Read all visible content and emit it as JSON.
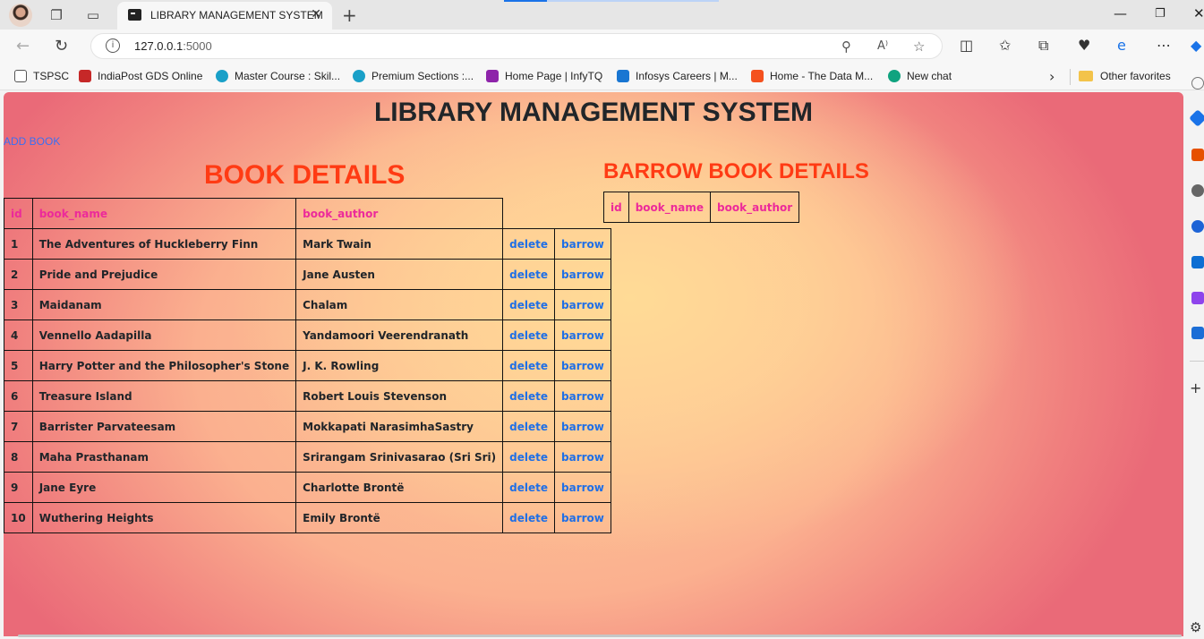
{
  "browser": {
    "tab_title": "LIBRARY MANAGEMENT SYSTEM",
    "url_host": "127.0.0.1",
    "url_port": ":5000",
    "bookmarks": [
      {
        "label": "TSPSC",
        "icon": "page-icon",
        "color": "#555555"
      },
      {
        "label": "IndiaPost GDS Online",
        "icon": "indiapost-icon",
        "color": "#c62828"
      },
      {
        "label": "Master Course : Skil...",
        "icon": "skill-icon",
        "color": "#1aa0c8"
      },
      {
        "label": "Premium Sections :...",
        "icon": "skill-icon",
        "color": "#1aa0c8"
      },
      {
        "label": "Home Page | InfyTQ",
        "icon": "infytq-icon",
        "color": "#8e24aa"
      },
      {
        "label": "Infosys Careers | M...",
        "icon": "infosys-icon",
        "color": "#1976d2"
      },
      {
        "label": "Home - The Data M...",
        "icon": "datam-icon",
        "color": "#f4511e"
      },
      {
        "label": "New chat",
        "icon": "chatgpt-icon",
        "color": "#10a37f"
      }
    ],
    "other_favorites": "Other favorites"
  },
  "page": {
    "title": "LIBRARY MANAGEMENT SYSTEM",
    "add_book_link": "ADD BOOK",
    "book_section_title": "BOOK DETAILS",
    "borrow_section_title": "BARROW BOOK DETAILS"
  },
  "books_table": {
    "headers": [
      "id",
      "book_name",
      "book_author"
    ],
    "delete_label": "delete",
    "borrow_label": "barrow",
    "rows": [
      {
        "id": "1",
        "book_name": "The Adventures of Huckleberry Finn",
        "book_author": "Mark Twain"
      },
      {
        "id": "2",
        "book_name": "Pride and Prejudice",
        "book_author": "Jane Austen"
      },
      {
        "id": "3",
        "book_name": "Maidanam",
        "book_author": "Chalam"
      },
      {
        "id": "4",
        "book_name": "Vennello Aadapilla",
        "book_author": "Yandamoori Veerendranath"
      },
      {
        "id": "5",
        "book_name": "Harry Potter and the Philosopher's Stone",
        "book_author": "J. K. Rowling"
      },
      {
        "id": "6",
        "book_name": "Treasure Island",
        "book_author": "Robert Louis Stevenson"
      },
      {
        "id": "7",
        "book_name": "Barrister Parvateesam",
        "book_author": "Mokkapati NarasimhaSastry"
      },
      {
        "id": "8",
        "book_name": "Maha Prasthanam",
        "book_author": "Srirangam Srinivasarao (Sri Sri)"
      },
      {
        "id": "9",
        "book_name": "Jane Eyre",
        "book_author": "Charlotte Brontë"
      },
      {
        "id": "10",
        "book_name": "Wuthering Heights",
        "book_author": "Emily Brontë"
      }
    ]
  },
  "borrow_table": {
    "headers": [
      "id",
      "book_name",
      "book_author"
    ]
  }
}
